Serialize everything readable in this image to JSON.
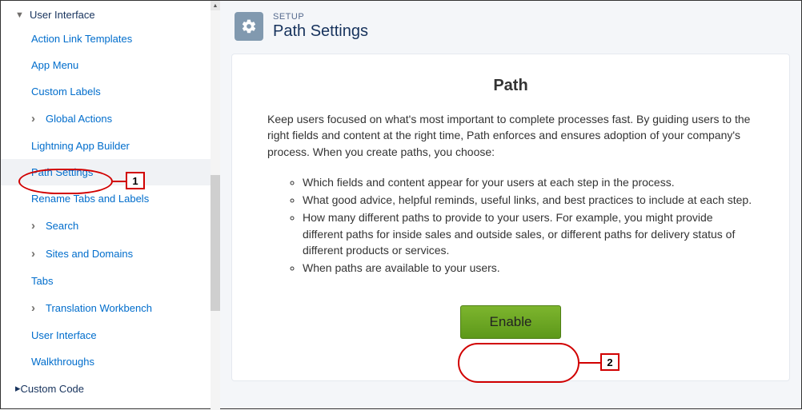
{
  "sidebar": {
    "section_label": "User Interface",
    "items": [
      {
        "label": "Action Link Templates",
        "sub": false
      },
      {
        "label": "App Menu",
        "sub": false
      },
      {
        "label": "Custom Labels",
        "sub": false
      },
      {
        "label": "Global Actions",
        "sub": true
      },
      {
        "label": "Lightning App Builder",
        "sub": false
      },
      {
        "label": "Path Settings",
        "sub": false,
        "active": true
      },
      {
        "label": "Rename Tabs and Labels",
        "sub": false
      },
      {
        "label": "Search",
        "sub": true
      },
      {
        "label": "Sites and Domains",
        "sub": true
      },
      {
        "label": "Tabs",
        "sub": false
      },
      {
        "label": "Translation Workbench",
        "sub": true
      },
      {
        "label": "User Interface",
        "sub": false
      },
      {
        "label": "Walkthroughs",
        "sub": false
      }
    ],
    "collapsed_section": "Custom Code"
  },
  "header": {
    "eyebrow": "SETUP",
    "title": "Path Settings"
  },
  "card": {
    "heading": "Path",
    "lead": "Keep users focused on what's most important to complete processes fast. By guiding users to the right fields and content at the right time, Path enforces and ensures adoption of your company's process. When you create paths, you choose:",
    "bullets": [
      "Which fields and content appear for your users at each step in the process.",
      "What good advice, helpful reminds, useful links, and best practices to include at each step.",
      "How many different paths to provide to your users. For example, you might provide different paths for inside sales and outside sales, or different paths for delivery status of different products or services.",
      "When paths are available to your users."
    ],
    "button_label": "Enable"
  },
  "callouts": {
    "one": "1",
    "two": "2"
  }
}
